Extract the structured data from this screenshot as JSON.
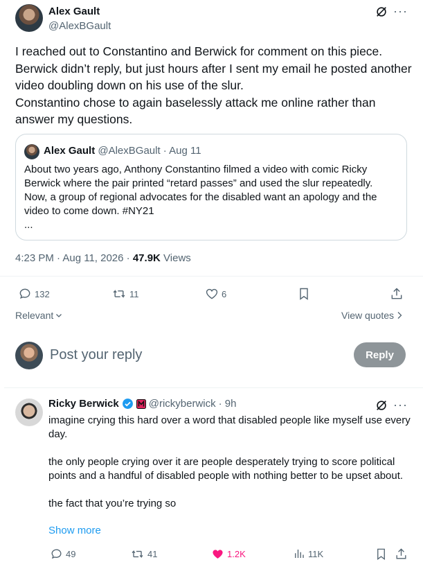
{
  "main_tweet": {
    "author_name": "Alex Gault",
    "author_handle": "@AlexBGault",
    "more_icon": "more-icon",
    "text": "I reached out to Constantino and Berwick for comment on this piece. Berwick didn’t reply, but just hours after I sent my email he posted another video doubling down on his use of the slur.\nConstantino chose to again baselessly attack me online rather than answer my questions.",
    "quote": {
      "author_name": "Alex Gault",
      "author_handle": "@AlexBGault",
      "date": "· Aug 11",
      "text": "About two years ago, Anthony Constantino filmed a video with comic Ricky Berwick where the pair printed “retard passes” and used the slur repeatedly. Now, a group of regional advocates for the disabled want an apology and the video to come down. #NY21\n..."
    },
    "timestamp": "4:23 PM · Aug 11, 2026 ·",
    "views_count": "47.9K",
    "views_label": "Views",
    "actions": {
      "replies": "132",
      "retweets": "11",
      "likes": "6"
    }
  },
  "sort": {
    "relevant_label": "Relevant",
    "view_quotes_label": "View quotes"
  },
  "composer": {
    "placeholder": "Post your reply",
    "reply_button": "Reply"
  },
  "reply_tweet": {
    "author_name": "Ricky Berwick",
    "author_handle": "@rickyberwick",
    "time": "· 9h",
    "text": "imagine crying this hard over a word that disabled people like myself use every day.\n\nthe only people crying over it are people desperately trying to score political points and a handful of disabled people with nothing better to be upset about.\n\nthe fact that you’re trying so",
    "show_more": "Show more",
    "actions": {
      "replies": "49",
      "retweets": "41",
      "likes": "1.2K",
      "views": "11K"
    }
  },
  "colors": {
    "text": "#0f1419",
    "muted": "#536471",
    "link": "#1d9bf0",
    "like_active": "#f91880",
    "verified": "#1d9bf0",
    "divider": "#eff3f4"
  }
}
